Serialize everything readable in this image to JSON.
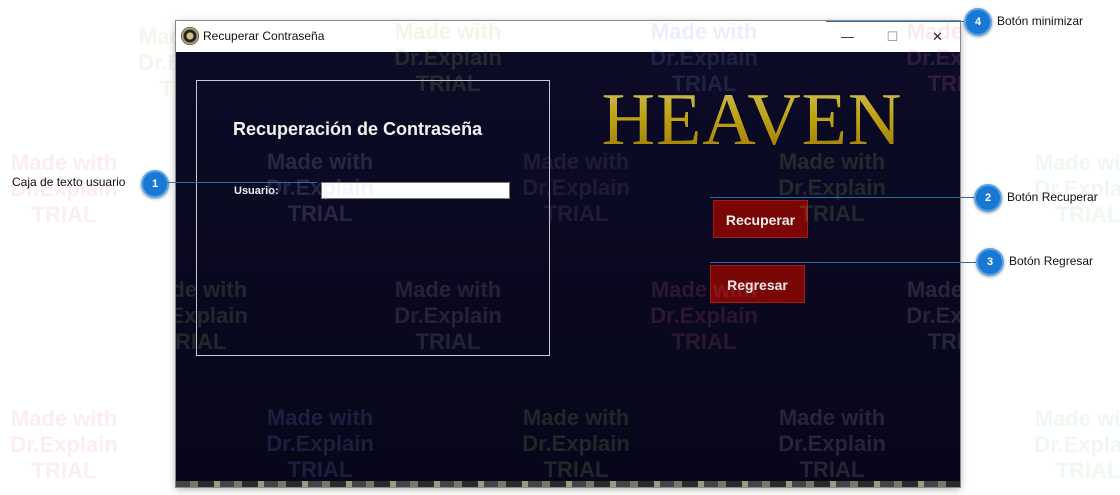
{
  "watermark": {
    "line1": "Made with",
    "line2": "Dr.Explain",
    "line3": "TRIAL"
  },
  "window": {
    "title": "Recuperar Contraseña",
    "minimize_glyph": "—",
    "maximize_glyph": "☐",
    "close_glyph": "✕"
  },
  "form": {
    "group_title": "Recuperación de Contraseña",
    "user_label": "Usuario:",
    "user_value": "",
    "logo_text": "HEAVEN",
    "recover_label": "Recuperar",
    "back_label": "Regresar"
  },
  "callouts": [
    {
      "number": "1",
      "label": "Caja de texto usuario"
    },
    {
      "number": "2",
      "label": "Botón Recuperar"
    },
    {
      "number": "3",
      "label": "Botón Regresar"
    },
    {
      "number": "4",
      "label": "Botón minimizar"
    }
  ],
  "colors": {
    "window_background": "#0b0a22",
    "logo_gold": "#e2c21c",
    "button_red": "#7a0606",
    "callout_blue": "#1a78d2"
  }
}
